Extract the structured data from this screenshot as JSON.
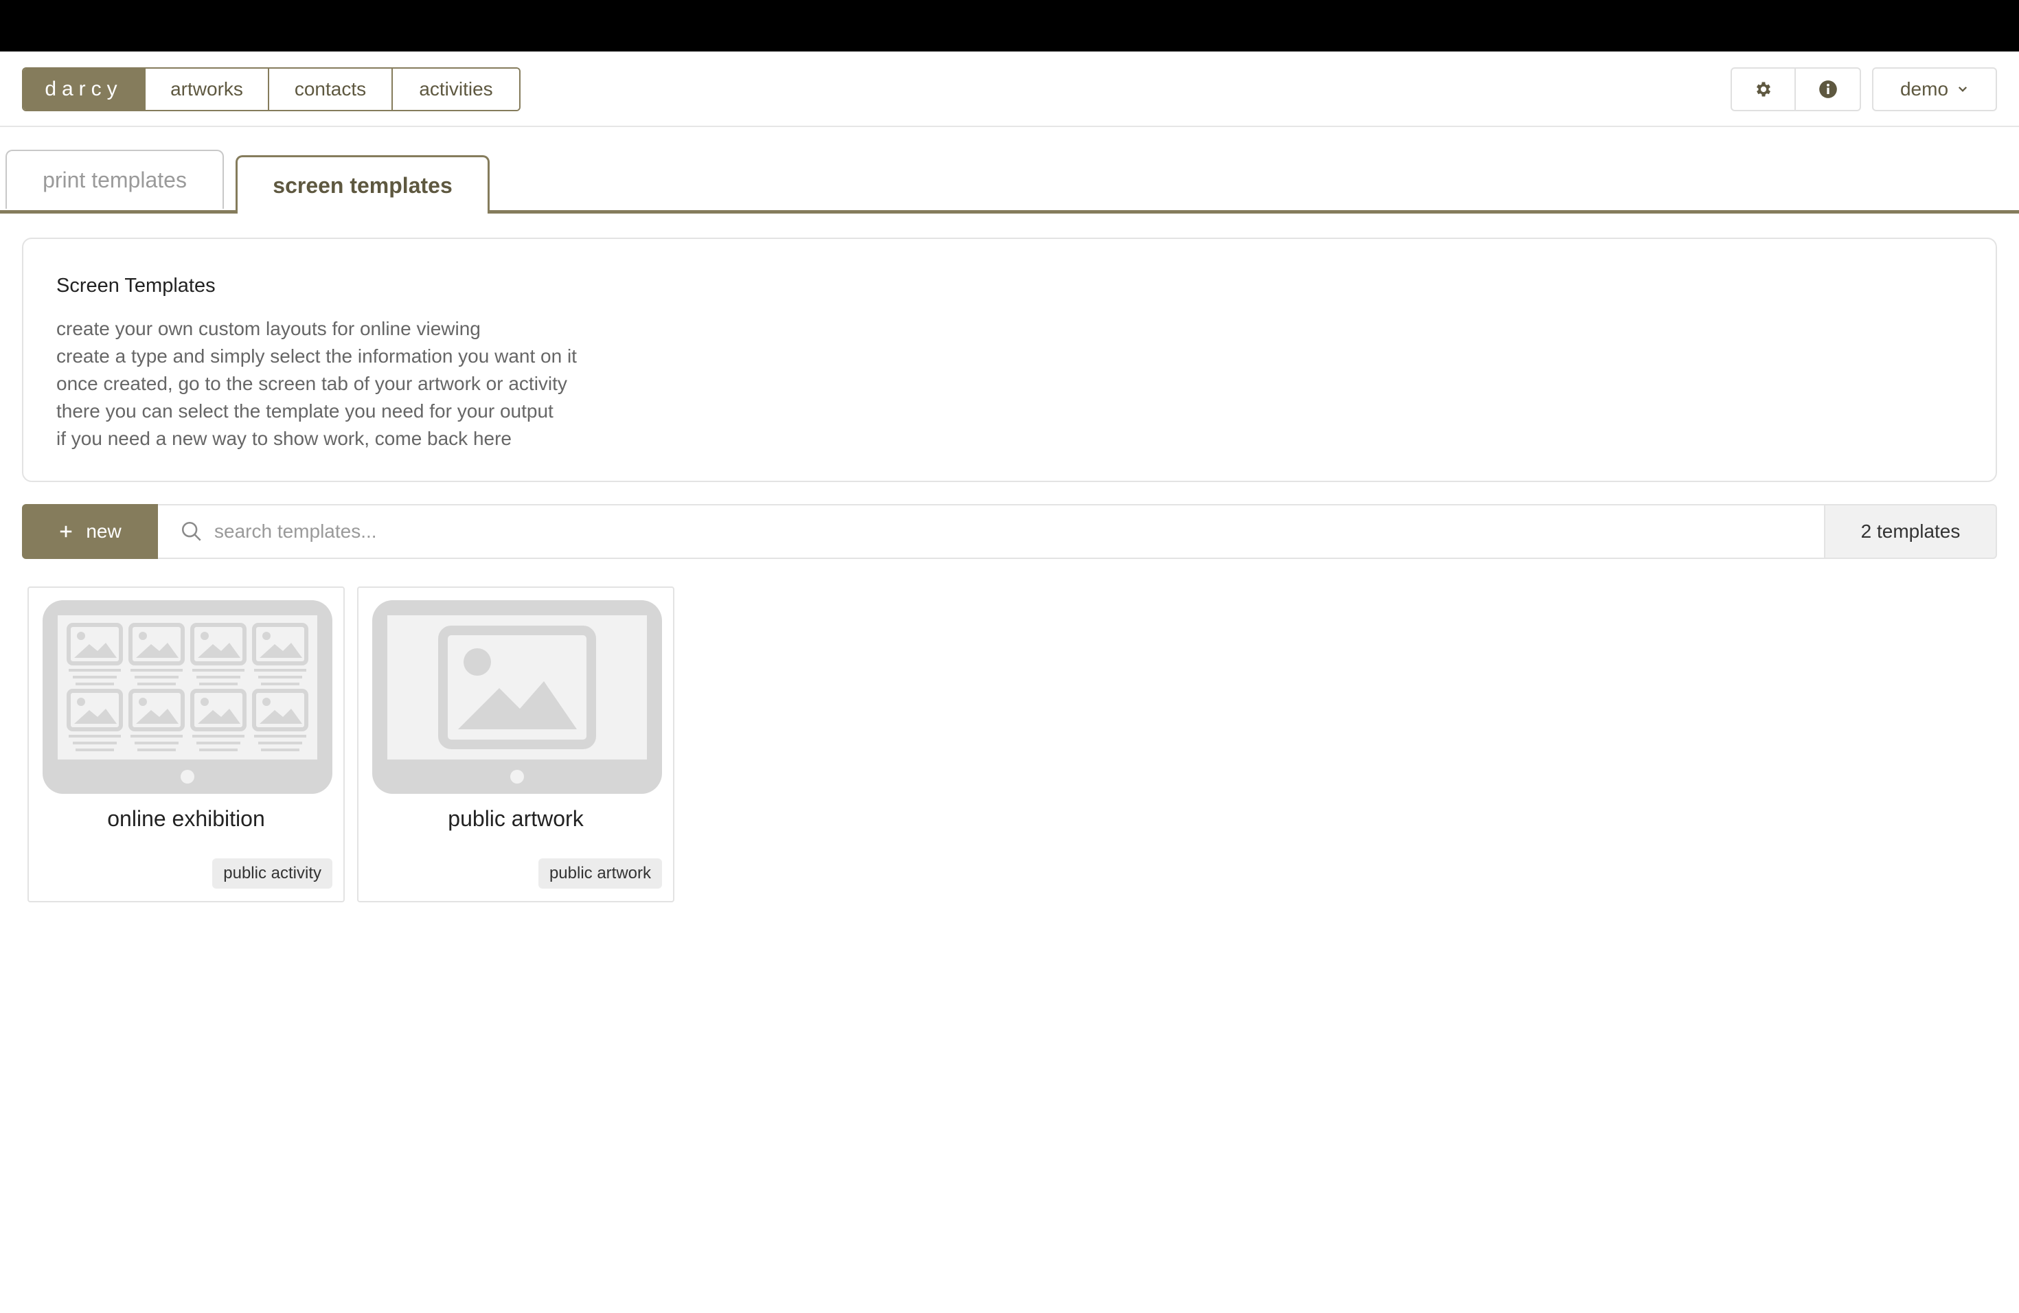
{
  "nav": {
    "brand": "darcy",
    "items": [
      "artworks",
      "contacts",
      "activities"
    ],
    "user_label": "demo",
    "accent_color": "#857c5c"
  },
  "tabs": [
    {
      "label": "print templates",
      "active": false
    },
    {
      "label": "screen templates",
      "active": true
    }
  ],
  "info": {
    "title": "Screen Templates",
    "lines": [
      "create your own custom layouts for online viewing",
      "create a type and simply select the information you want on it",
      "once created, go to the screen tab of your artwork or activity",
      "there you can select the template you need for your output",
      "if you need a new way to show work, come back here"
    ]
  },
  "toolbar": {
    "new_label": "new",
    "search_placeholder": "search templates...",
    "count_label": "2 templates"
  },
  "templates": [
    {
      "name": "online exhibition",
      "badge": "public activity",
      "preview": "grid-icon"
    },
    {
      "name": "public artwork",
      "badge": "public artwork",
      "preview": "single-image-icon"
    }
  ]
}
